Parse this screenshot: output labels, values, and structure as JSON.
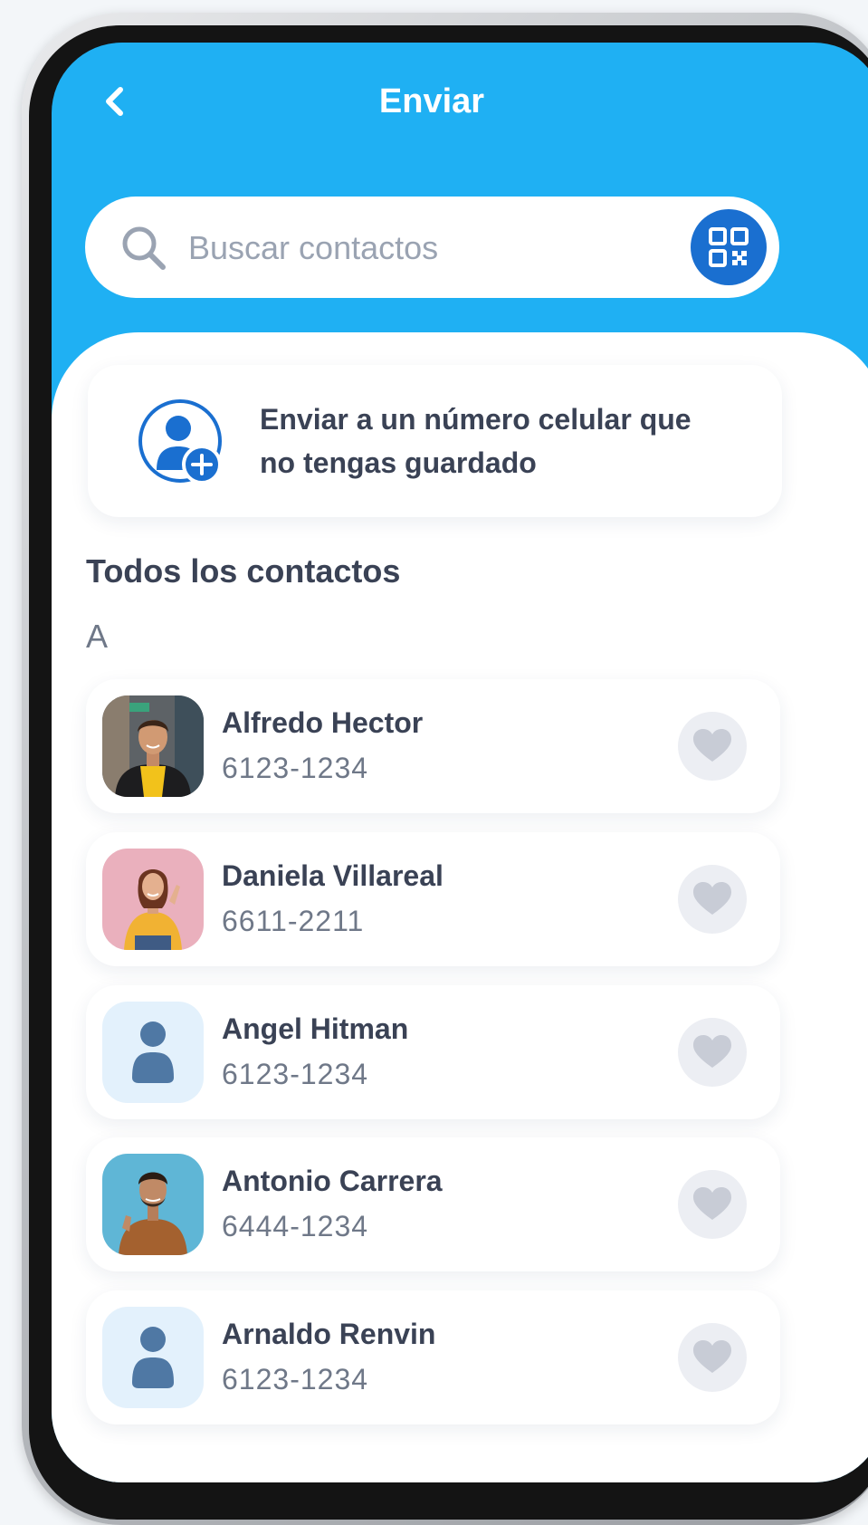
{
  "header": {
    "title": "Enviar"
  },
  "search": {
    "placeholder": "Buscar contactos",
    "value": ""
  },
  "send_to_number": {
    "text": "Enviar a un número celular que no tengas guardado"
  },
  "contacts_section": {
    "title": "Todos los contactos",
    "letter": "A"
  },
  "contacts": [
    {
      "name": "Alfredo Hector",
      "phone": "6123-1234",
      "avatar": "photo-man-yellow-hoodie"
    },
    {
      "name": "Daniela Villareal",
      "phone": "6611-2211",
      "avatar": "photo-woman-yellow-shirt"
    },
    {
      "name": "Angel Hitman",
      "phone": "6123-1234",
      "avatar": "default-person-icon"
    },
    {
      "name": "Antonio Carrera",
      "phone": "6444-1234",
      "avatar": "photo-man-thumbs-up"
    },
    {
      "name": "Arnaldo Renvin",
      "phone": "6123-1234",
      "avatar": "default-person-icon"
    }
  ],
  "colors": {
    "header_bg": "#1fb0f3",
    "qr_button": "#1a6fd0",
    "text_dark": "#3a4255",
    "text_muted": "#6f7888",
    "favorite_bg": "#eceef3",
    "favorite_icon": "#c8ccd6"
  },
  "icons": {
    "back": "chevron-left-icon",
    "search": "search-icon",
    "qr": "qr-code-icon",
    "add_contact": "add-person-icon",
    "favorite": "heart-icon"
  }
}
